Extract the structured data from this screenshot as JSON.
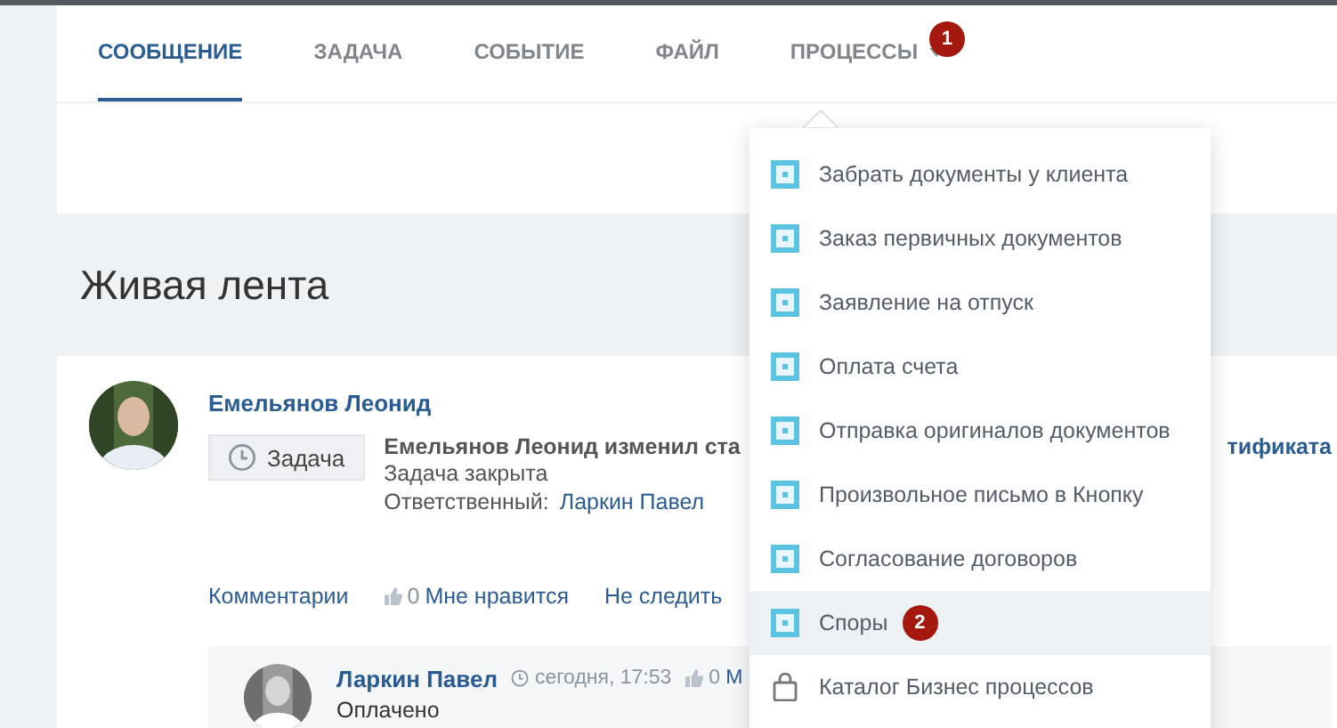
{
  "tabs": [
    {
      "label": "СООБЩЕНИЕ",
      "selected": true,
      "dropdown": false
    },
    {
      "label": "ЗАДАЧА",
      "selected": false,
      "dropdown": false
    },
    {
      "label": "СОБЫТИЕ",
      "selected": false,
      "dropdown": false
    },
    {
      "label": "ФАЙЛ",
      "selected": false,
      "dropdown": false
    },
    {
      "label": "ПРОЦЕССЫ",
      "selected": false,
      "dropdown": true,
      "badge": "1"
    }
  ],
  "heading": "Живая лента",
  "post": {
    "author": "Емельянов Леонид",
    "type_label": "Задача",
    "summary": "Емельянов Леонид изменил ста",
    "summary_tail": "тификата",
    "status": "Задача закрыта",
    "responsible_label": "Ответственный:",
    "responsible": "Ларкин Павел",
    "actions": [
      {
        "kind": "link",
        "label": "Комментарии"
      },
      {
        "kind": "like",
        "count": "0",
        "label": "Мне нравится"
      },
      {
        "kind": "link",
        "label": "Не следить"
      }
    ]
  },
  "comment": {
    "author": "Ларкин Павел",
    "time": "сегодня, 17:53",
    "like_count": "0",
    "like_label": "М",
    "text": "Оплачено"
  },
  "menu": {
    "items": [
      {
        "kind": "process",
        "label": "Забрать документы у клиента",
        "selected": false
      },
      {
        "kind": "process",
        "label": "Заказ первичных документов",
        "selected": false
      },
      {
        "kind": "process",
        "label": "Заявление на отпуск",
        "selected": false
      },
      {
        "kind": "process",
        "label": "Оплата счета",
        "selected": false
      },
      {
        "kind": "process",
        "label": "Отправка оригиналов документов",
        "selected": false
      },
      {
        "kind": "process",
        "label": "Произвольное письмо в Кнопку",
        "selected": false
      },
      {
        "kind": "process",
        "label": "Согласование договоров",
        "selected": false
      },
      {
        "kind": "process",
        "label": "Споры",
        "selected": true,
        "badge": "2"
      },
      {
        "kind": "catalog",
        "label": "Каталог Бизнес процессов",
        "selected": false
      }
    ]
  }
}
